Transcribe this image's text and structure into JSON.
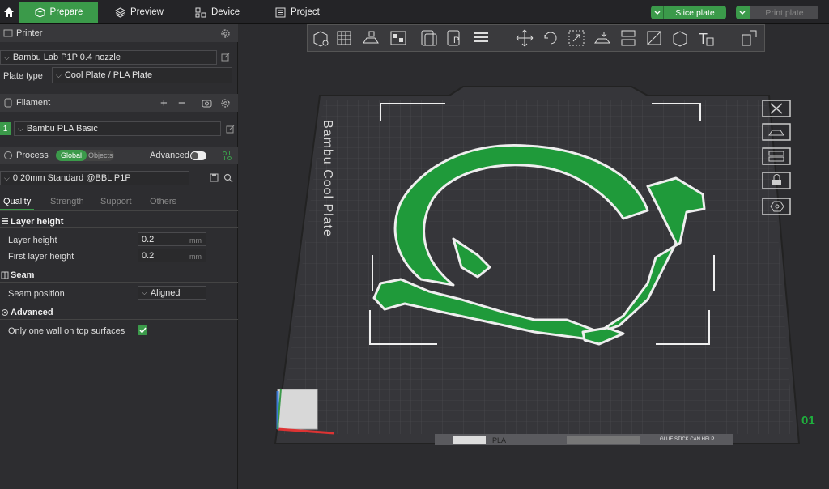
{
  "tabs": [
    {
      "label": "Prepare",
      "icon": "cube-icon"
    },
    {
      "label": "Preview",
      "icon": "layers-icon"
    },
    {
      "label": "Device",
      "icon": "device-icon"
    },
    {
      "label": "Project",
      "icon": "project-icon"
    }
  ],
  "actions": {
    "slice_label": "Slice plate",
    "print_label": "Print plate"
  },
  "printer": {
    "section_title": "Printer",
    "name": "Bambu Lab P1P 0.4 nozzle",
    "plate_type_label": "Plate type",
    "plate_type_value": "Cool Plate / PLA Plate"
  },
  "filament": {
    "section_title": "Filament",
    "slot_number": "1",
    "name": "Bambu PLA Basic"
  },
  "process": {
    "section_title": "Process",
    "toggle_global": "Global",
    "toggle_objects": "Objects",
    "advanced_label": "Advanced",
    "preset": "0.20mm Standard @BBL P1P",
    "tabs": [
      "Quality",
      "Strength",
      "Support",
      "Others"
    ]
  },
  "settings": {
    "layer_height_title": "Layer height",
    "layer_height_label": "Layer height",
    "layer_height_value": "0.2",
    "first_layer_label": "First layer height",
    "first_layer_value": "0.2",
    "unit": "mm",
    "seam_title": "Seam",
    "seam_position_label": "Seam position",
    "seam_position_value": "Aligned",
    "advanced_title": "Advanced",
    "one_wall_label": "Only one wall on top surfaces",
    "one_wall_checked": true
  },
  "plate": {
    "brand_text": "Bambu Cool Plate",
    "material": "PLA",
    "plate_number": "01",
    "glue_text": "GLUE STICK CAN HELP."
  },
  "colors": {
    "accent": "#3b9a4a",
    "model": "#1f9a3a"
  }
}
